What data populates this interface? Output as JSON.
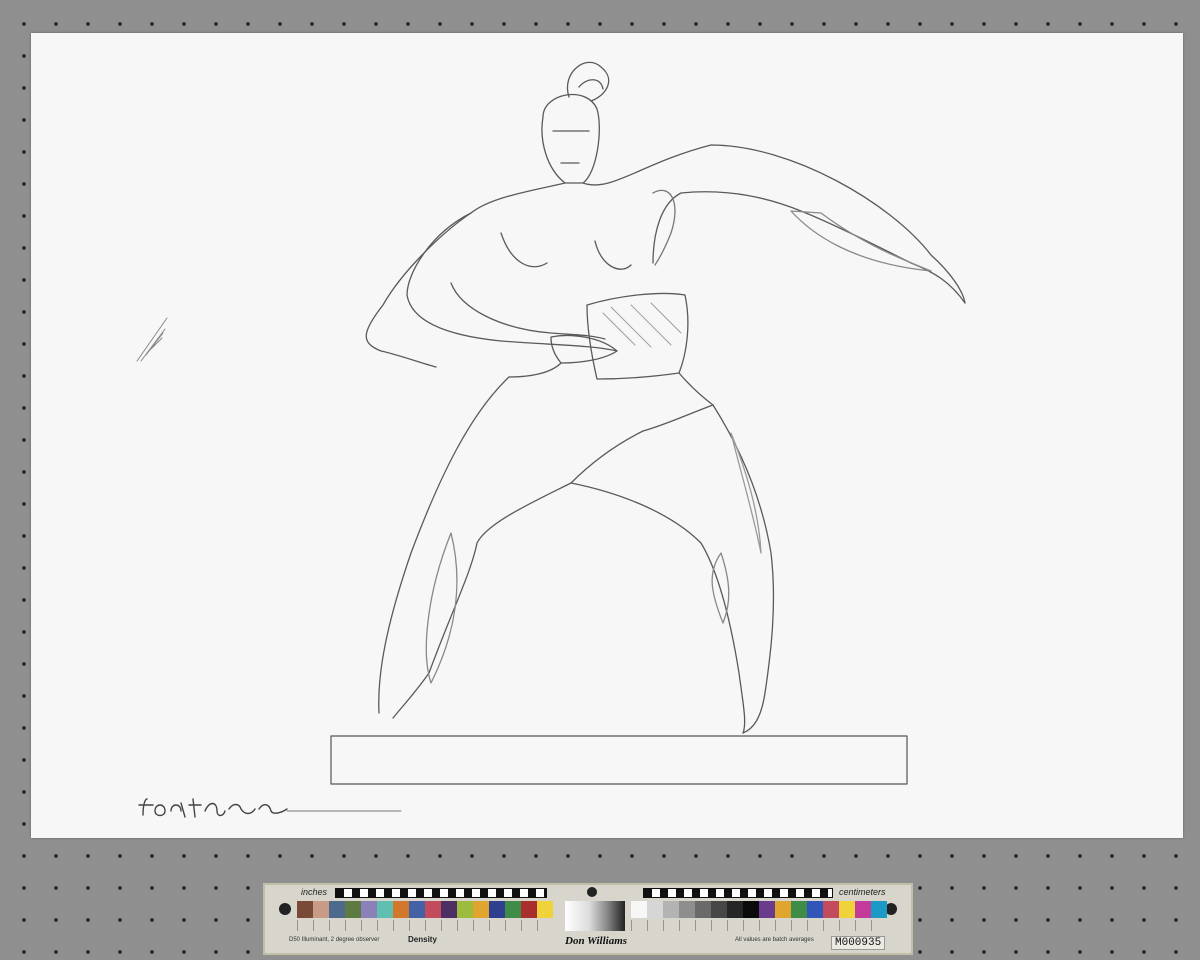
{
  "drawing": {
    "subject": "pencil-drawing-dancing-figure-on-plinth",
    "signature": "signature"
  },
  "color_target": {
    "inches_label": "inches",
    "centimeters_label": "centimeters",
    "caption_left": "D50 Illuminant, 2 degree observer",
    "density_label": "Density",
    "brand": "Don Williams",
    "batch_note": "All values are batch averages",
    "serial": "M000935",
    "swatch_colors_left": [
      "#7a4a38",
      "#c99a86",
      "#4d6a8c",
      "#5e7a43",
      "#8c80b8",
      "#5fbfb0",
      "#d1782c",
      "#4461a6",
      "#c34b5e",
      "#4e2f63",
      "#9bbc3d",
      "#e0a52f",
      "#2f3f8f",
      "#3f8b48",
      "#a92e2e",
      "#f0d23a"
    ],
    "swatch_colors_right": [
      "#f7f7f7",
      "#d6d6d6",
      "#b3b3b3",
      "#8e8e8e",
      "#6a6a6a",
      "#474747",
      "#262626",
      "#0a0a0a",
      "#6a3a8c",
      "#e0a52f",
      "#3f8b48",
      "#2f56b8",
      "#c34b5e",
      "#f0d23a",
      "#c43a9a",
      "#1a9ac4"
    ]
  }
}
